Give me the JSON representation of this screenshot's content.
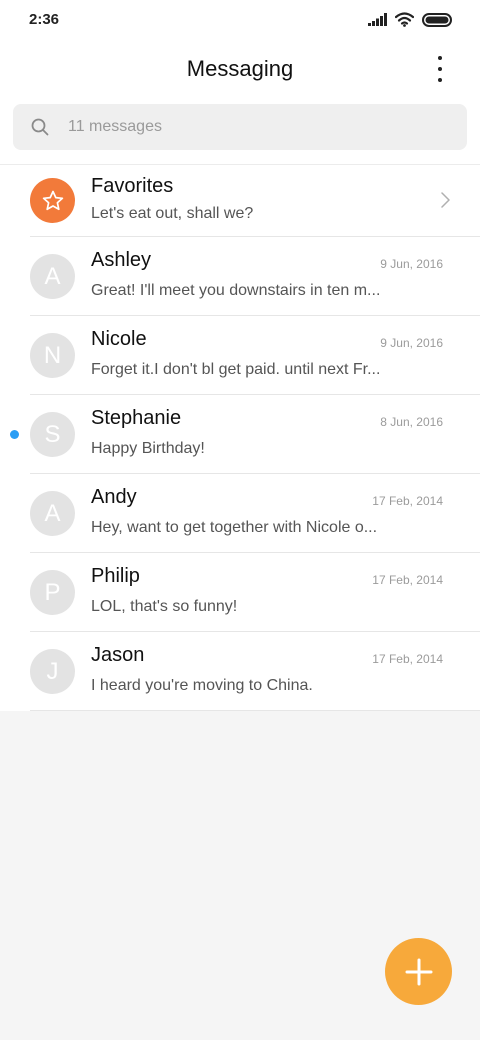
{
  "status_bar": {
    "time": "2:36",
    "icons": [
      "signal-icon",
      "wifi-icon",
      "battery-icon"
    ]
  },
  "header": {
    "title": "Messaging",
    "menu_icon": "more-vertical-icon"
  },
  "search": {
    "placeholder": "11 messages",
    "value": "",
    "icon": "search-icon"
  },
  "favorites": {
    "name": "Favorites",
    "preview": "Let's eat out, shall we?",
    "icon": "star-icon",
    "accent": "#f27a3a"
  },
  "conversations": [
    {
      "initial": "A",
      "name": "Ashley",
      "date": "9 Jun, 2016",
      "preview": "Great! I'll meet you downstairs in ten m...",
      "unread": false
    },
    {
      "initial": "N",
      "name": "Nicole",
      "date": "9 Jun, 2016",
      "preview": "Forget it.I don't bl get paid. until next Fr...",
      "unread": false
    },
    {
      "initial": "S",
      "name": "Stephanie",
      "date": "8 Jun, 2016",
      "preview": "Happy Birthday!",
      "unread": true
    },
    {
      "initial": "A",
      "name": "Andy",
      "date": "17 Feb, 2014",
      "preview": "Hey, want to get together with Nicole o...",
      "unread": false
    },
    {
      "initial": "P",
      "name": "Philip",
      "date": "17 Feb, 2014",
      "preview": "LOL, that's so funny!",
      "unread": false
    },
    {
      "initial": "J",
      "name": "Jason",
      "date": "17 Feb, 2014",
      "preview": "I heard you're moving to China.",
      "unread": false
    }
  ],
  "colors": {
    "unread_dot": "#2a9df4",
    "fab": "#f7a93b",
    "avatar_bg": "#e3e3e3"
  },
  "fab": {
    "icon": "plus-icon"
  }
}
